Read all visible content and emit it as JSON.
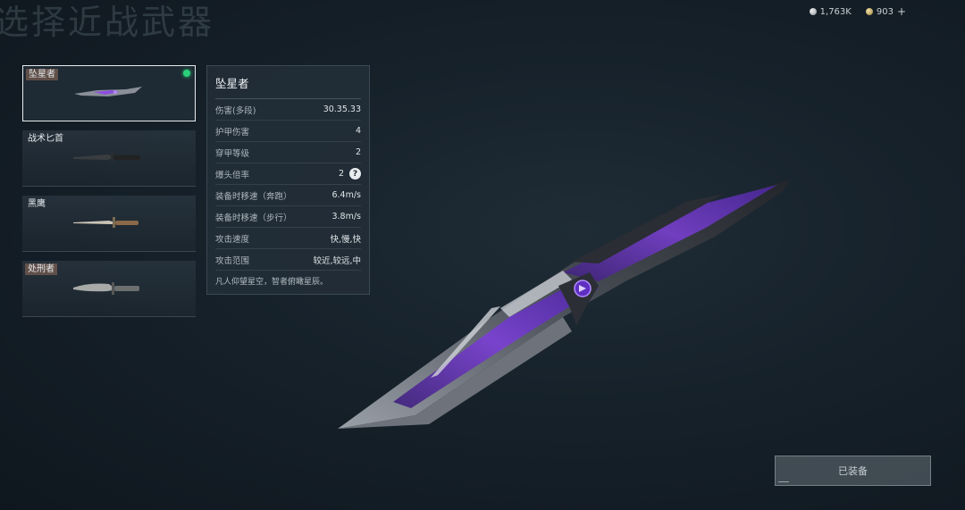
{
  "header": {
    "title": "选择近战武器"
  },
  "currency": [
    {
      "icon": "silver-coin-icon",
      "value": "1,763K"
    },
    {
      "icon": "gold-coin-icon",
      "value": "903"
    }
  ],
  "currency_add": "+",
  "weapons": [
    {
      "name": "坠星者",
      "selected": true,
      "equipped": true
    },
    {
      "name": "战术匕首",
      "selected": false,
      "equipped": false
    },
    {
      "name": "黑鹰",
      "selected": false,
      "equipped": false
    },
    {
      "name": "处刑者",
      "selected": false,
      "equipped": false
    }
  ],
  "stats": {
    "title": "坠星者",
    "rows": [
      {
        "label": "伤害(多段)",
        "value": "30.35.33"
      },
      {
        "label": "护甲伤害",
        "value": "4"
      },
      {
        "label": "穿甲等级",
        "value": "2"
      },
      {
        "label": "爆头倍率",
        "value": "2"
      },
      {
        "label": "装备时移速（奔跑）",
        "value": "6.4m/s"
      },
      {
        "label": "装备时移速（步行）",
        "value": "3.8m/s"
      },
      {
        "label": "攻击速度",
        "value": "快,慢,快"
      },
      {
        "label": "攻击范围",
        "value": "较近,较远,中"
      }
    ],
    "help_icon": "?",
    "description": "凡人仰望星空，智者俯瞰星辰。"
  },
  "equip_button": {
    "label": "已装备"
  },
  "colors": {
    "accent_purple": "#7b3fd6",
    "equipped_dot": "#2ad17a"
  }
}
